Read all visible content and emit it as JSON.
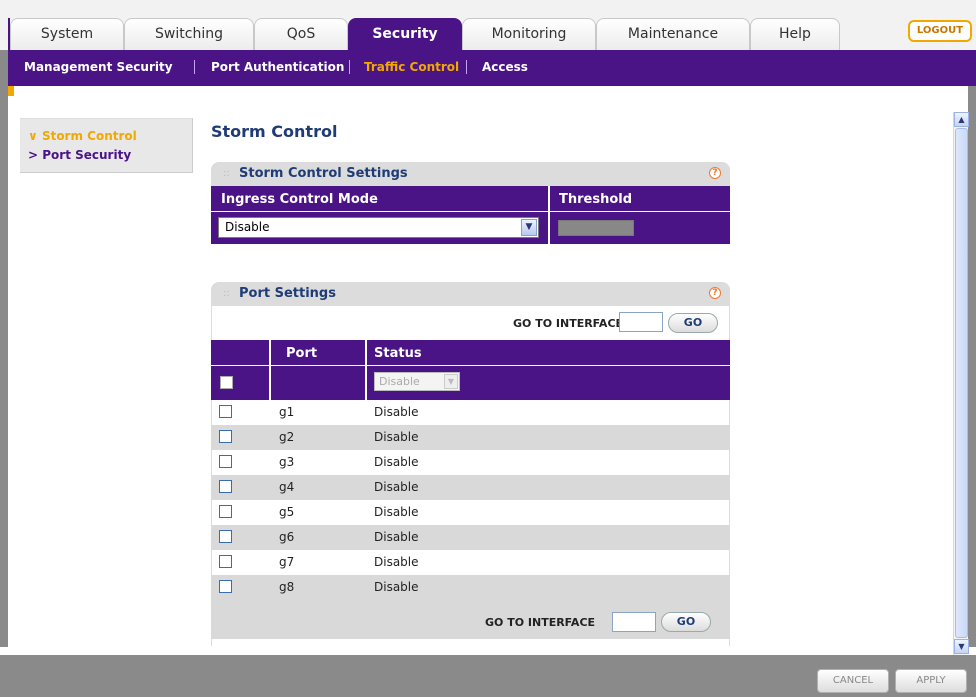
{
  "tabs": [
    {
      "label": "System"
    },
    {
      "label": "Switching"
    },
    {
      "label": "QoS"
    },
    {
      "label": "Security"
    },
    {
      "label": "Monitoring"
    },
    {
      "label": "Maintenance"
    },
    {
      "label": "Help"
    }
  ],
  "active_tab": "Security",
  "logout_label": "LOGOUT",
  "subnav": [
    {
      "label": "Management Security"
    },
    {
      "label": "Port Authentication"
    },
    {
      "label": "Traffic Control"
    },
    {
      "label": "Access"
    }
  ],
  "active_subnav": "Traffic Control",
  "sidemenu": [
    {
      "label": "Storm Control",
      "bullet": "∨"
    },
    {
      "label": "Port Security",
      "bullet": ">"
    }
  ],
  "page_title": "Storm Control",
  "storm_settings": {
    "title": "Storm Control Settings",
    "col_mode": "Ingress Control Mode",
    "col_threshold": "Threshold",
    "mode_value": "Disable",
    "threshold_value": ""
  },
  "port_settings": {
    "title": "Port Settings",
    "goto_label": "GO TO INTERFACE",
    "go_label": "GO",
    "col_port": "Port",
    "col_status": "Status",
    "all_status": "Disable",
    "rows": [
      {
        "port": "g1",
        "status": "Disable"
      },
      {
        "port": "g2",
        "status": "Disable"
      },
      {
        "port": "g3",
        "status": "Disable"
      },
      {
        "port": "g4",
        "status": "Disable"
      },
      {
        "port": "g5",
        "status": "Disable"
      },
      {
        "port": "g6",
        "status": "Disable"
      },
      {
        "port": "g7",
        "status": "Disable"
      },
      {
        "port": "g8",
        "status": "Disable"
      }
    ]
  },
  "footer": {
    "cancel_label": "CANCEL",
    "apply_label": "APPLY"
  },
  "colors": {
    "brand_purple": "#4a1486",
    "accent_orange": "#f2a800",
    "title_blue": "#1f3c76"
  }
}
